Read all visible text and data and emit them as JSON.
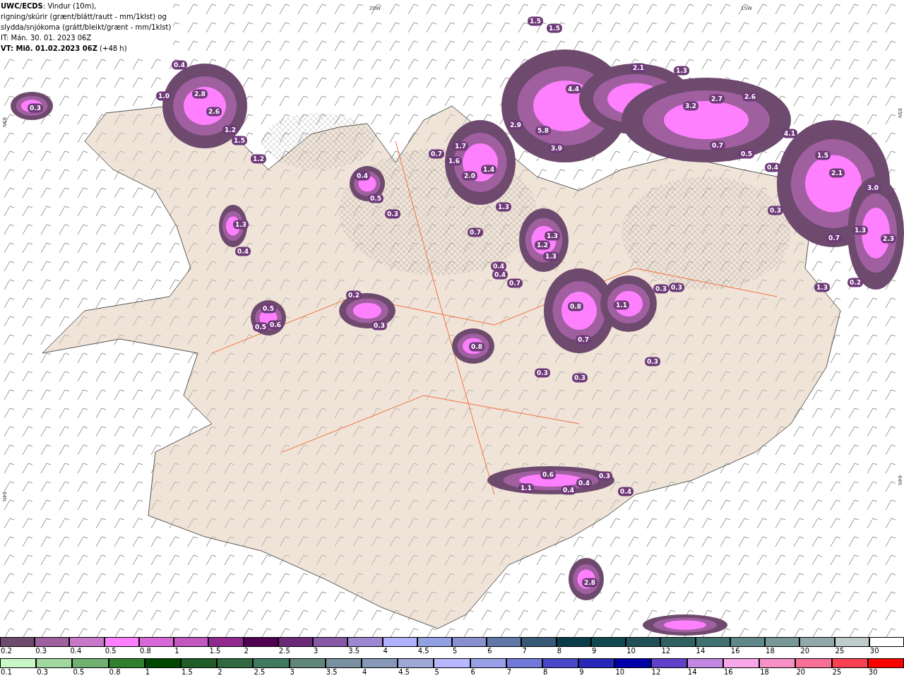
{
  "header": {
    "lines": [
      "**UWC/ECDS**: Vindur (10m),",
      "rigning/skúrir (grænt/blátt/rautt - mm/1klst) og",
      "slydda/snjókoma (grátt/bleikt/grænt - mm/1klst)",
      "IT: Mán. 30. 01. 2023 06Z",
      "**VT: Mið. 01.02.2023 06Z** (+48 h)"
    ]
  },
  "map": {
    "grid_labels": [
      "20W",
      "15W",
      "65N",
      "64N",
      "65N",
      "64N"
    ],
    "value_labels": [
      "1.5",
      "1.5",
      "2.1",
      "1.3",
      "4.4",
      "3.2",
      "2.7",
      "2.6",
      "2.9",
      "5.8",
      "3.9",
      "4.1",
      "0.7",
      "0.5",
      "1.5",
      "2.1",
      "3.0",
      "1.3",
      "0.7",
      "2.3",
      "0.4",
      "0.3",
      "0.4",
      "2.8",
      "2.6",
      "1.2",
      "1.5",
      "1.2",
      "0.3",
      "1.0",
      "0.4",
      "0.5",
      "0.3",
      "0.7",
      "1.6",
      "2.0",
      "1.4",
      "1.7",
      "1.3",
      "0.7",
      "1.3",
      "1.2",
      "1.3",
      "0.8",
      "0.7",
      "1.1",
      "0.5",
      "0.5",
      "0.6",
      "0.2",
      "0.3",
      "0.8",
      "0.3",
      "0.3",
      "0.3",
      "0.3",
      "0.3",
      "0.4",
      "0.4",
      "0.7",
      "1.1",
      "0.6",
      "0.4",
      "0.4",
      "0.3",
      "0.4",
      "2.8",
      "1.3",
      "0.4",
      "1.3",
      "0.2"
    ]
  },
  "legends": [
    {
      "cells": [
        {
          "label": "0.2",
          "color": "#6e4a6e"
        },
        {
          "label": "0.3",
          "color": "#a060a0"
        },
        {
          "label": "0.4",
          "color": "#c878c8"
        },
        {
          "label": "0.5",
          "color": "#ff80ff"
        },
        {
          "label": "0.8",
          "color": "#d868d8"
        },
        {
          "label": "1",
          "color": "#c058c0"
        },
        {
          "label": "1.5",
          "color": "#902890"
        },
        {
          "label": "2",
          "color": "#500050"
        },
        {
          "label": "2.5",
          "color": "#6a2878"
        },
        {
          "label": "3",
          "color": "#8858a8"
        },
        {
          "label": "3.5",
          "color": "#9c88d0"
        },
        {
          "label": "4",
          "color": "#b0b0ff"
        },
        {
          "label": "4.5",
          "color": "#90a0e0"
        },
        {
          "label": "5",
          "color": "#8890d0"
        },
        {
          "label": "6",
          "color": "#6078a8"
        },
        {
          "label": "7",
          "color": "#385878"
        },
        {
          "label": "8",
          "color": "#083c48"
        },
        {
          "label": "9",
          "color": "#104850"
        },
        {
          "label": "10",
          "color": "#205058"
        },
        {
          "label": "12",
          "color": "#306060"
        },
        {
          "label": "14",
          "color": "#407070"
        },
        {
          "label": "16",
          "color": "#608888"
        },
        {
          "label": "18",
          "color": "#789898"
        },
        {
          "label": "20",
          "color": "#90a8a8"
        },
        {
          "label": "25",
          "color": "#c0cccc"
        },
        {
          "label": "30",
          "color": "#ffffff"
        }
      ]
    },
    {
      "cells": [
        {
          "label": "0.1",
          "color": "#c8f8c8"
        },
        {
          "label": "0.3",
          "color": "#a0d8a0"
        },
        {
          "label": "0.5",
          "color": "#70b070"
        },
        {
          "label": "0.8",
          "color": "#308030"
        },
        {
          "label": "1",
          "color": "#004800"
        },
        {
          "label": "1.5",
          "color": "#205c28"
        },
        {
          "label": "2",
          "color": "#306840"
        },
        {
          "label": "2.5",
          "color": "#407860"
        },
        {
          "label": "3",
          "color": "#608878"
        },
        {
          "label": "3.5",
          "color": "#7890a0"
        },
        {
          "label": "4",
          "color": "#8898b8"
        },
        {
          "label": "4.5",
          "color": "#a0a8d8"
        },
        {
          "label": "5",
          "color": "#b8b8ff"
        },
        {
          "label": "6",
          "color": "#98a0e8"
        },
        {
          "label": "7",
          "color": "#7078d8"
        },
        {
          "label": "8",
          "color": "#4848c8"
        },
        {
          "label": "9",
          "color": "#2828b8"
        },
        {
          "label": "10",
          "color": "#0000a8"
        },
        {
          "label": "12",
          "color": "#6040c8"
        },
        {
          "label": "14",
          "color": "#c088e0"
        },
        {
          "label": "16",
          "color": "#f8a8e8"
        },
        {
          "label": "18",
          "color": "#f890c8"
        },
        {
          "label": "20",
          "color": "#f87098"
        },
        {
          "label": "25",
          "color": "#f84050"
        },
        {
          "label": "30",
          "color": "#ff0000"
        }
      ]
    }
  ]
}
